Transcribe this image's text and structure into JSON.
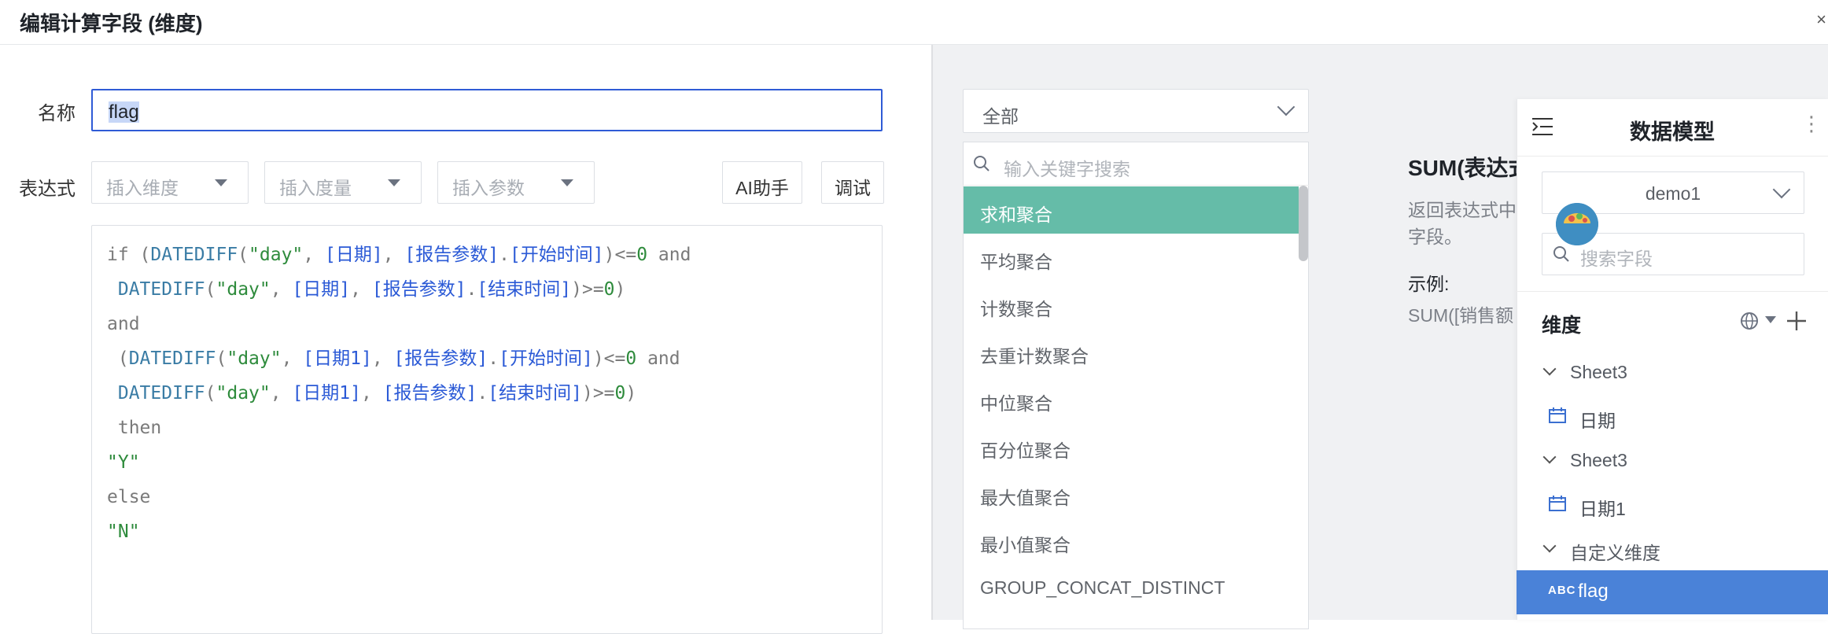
{
  "dialog": {
    "title": "编辑计算字段 (维度)",
    "close": "×"
  },
  "form": {
    "name_label": "名称",
    "name_value": "flag",
    "expr_label": "表达式",
    "insert_dimension": "插入维度",
    "insert_measure": "插入度量",
    "insert_param": "插入参数",
    "ai_button": "AI助手",
    "debug_button": "调试"
  },
  "code_lines": [
    "if (DATEDIFF(\"day\", [日期], [报告参数].[开始时间])<=0 and",
    " DATEDIFF(\"day\", [日期], [报告参数].[结束时间])>=0)",
    "and",
    " (DATEDIFF(\"day\", [日期1], [报告参数].[开始时间])<=0 and",
    " DATEDIFF(\"day\", [日期1], [报告参数].[结束时间])>=0)",
    " then",
    "\"Y\"",
    "else",
    "\"N\""
  ],
  "functions": {
    "category": "全部",
    "search_placeholder": "输入关键字搜索",
    "items": [
      "求和聚合",
      "平均聚合",
      "计数聚合",
      "去重计数聚合",
      "中位聚合",
      "百分位聚合",
      "最大值聚合",
      "最小值聚合",
      "GROUP_CONCAT_DISTINCT"
    ],
    "active_index": 0
  },
  "description": {
    "title": "SUM(表达式",
    "text_line1": "返回表达式中",
    "text_line2": "字段。",
    "example_label": "示例:",
    "example_code": "SUM([销售额"
  },
  "data_model": {
    "title": "数据模型",
    "more": "⋮",
    "model": "demo1",
    "search_placeholder": "搜索字段",
    "section_title": "维度",
    "tree": [
      {
        "label": "Sheet3",
        "type": "group"
      },
      {
        "label": "日期",
        "type": "date"
      },
      {
        "label": "Sheet3",
        "type": "group"
      },
      {
        "label": "日期1",
        "type": "date"
      },
      {
        "label": "自定义维度",
        "type": "group"
      },
      {
        "label": "flag",
        "type": "text",
        "badge": "ABC"
      }
    ]
  },
  "colors": {
    "accent": "#2f5bd6",
    "active_function": "#65bca8",
    "selected_field": "#4a82d8"
  }
}
